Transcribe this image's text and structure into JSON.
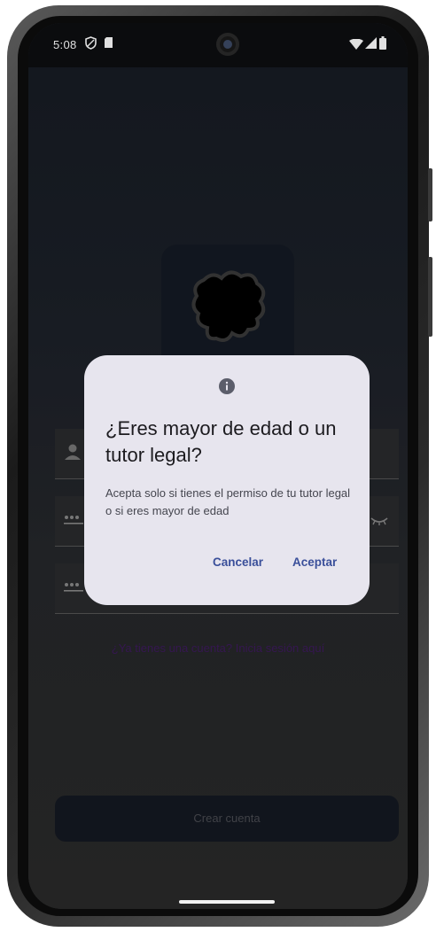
{
  "status_bar": {
    "time": "5:08",
    "left_icons": [
      "shield-icon",
      "sd-card-icon"
    ],
    "right_icons": [
      "wifi-icon",
      "signal-icon",
      "battery-icon"
    ]
  },
  "background_form": {
    "login_link": "¿Ya tienes una cuenta? Inicia sesión aquí",
    "create_button": "Crear cuenta"
  },
  "dialog": {
    "icon": "info-icon",
    "title": "¿Eres mayor de edad o un tutor legal?",
    "body": "Acepta solo si tienes el permiso de tu tutor legal o si eres mayor de edad",
    "cancel_label": "Cancelar",
    "accept_label": "Aceptar"
  },
  "colors": {
    "dialog_bg": "#e7e5ee",
    "accent": "#3a4f9a"
  }
}
